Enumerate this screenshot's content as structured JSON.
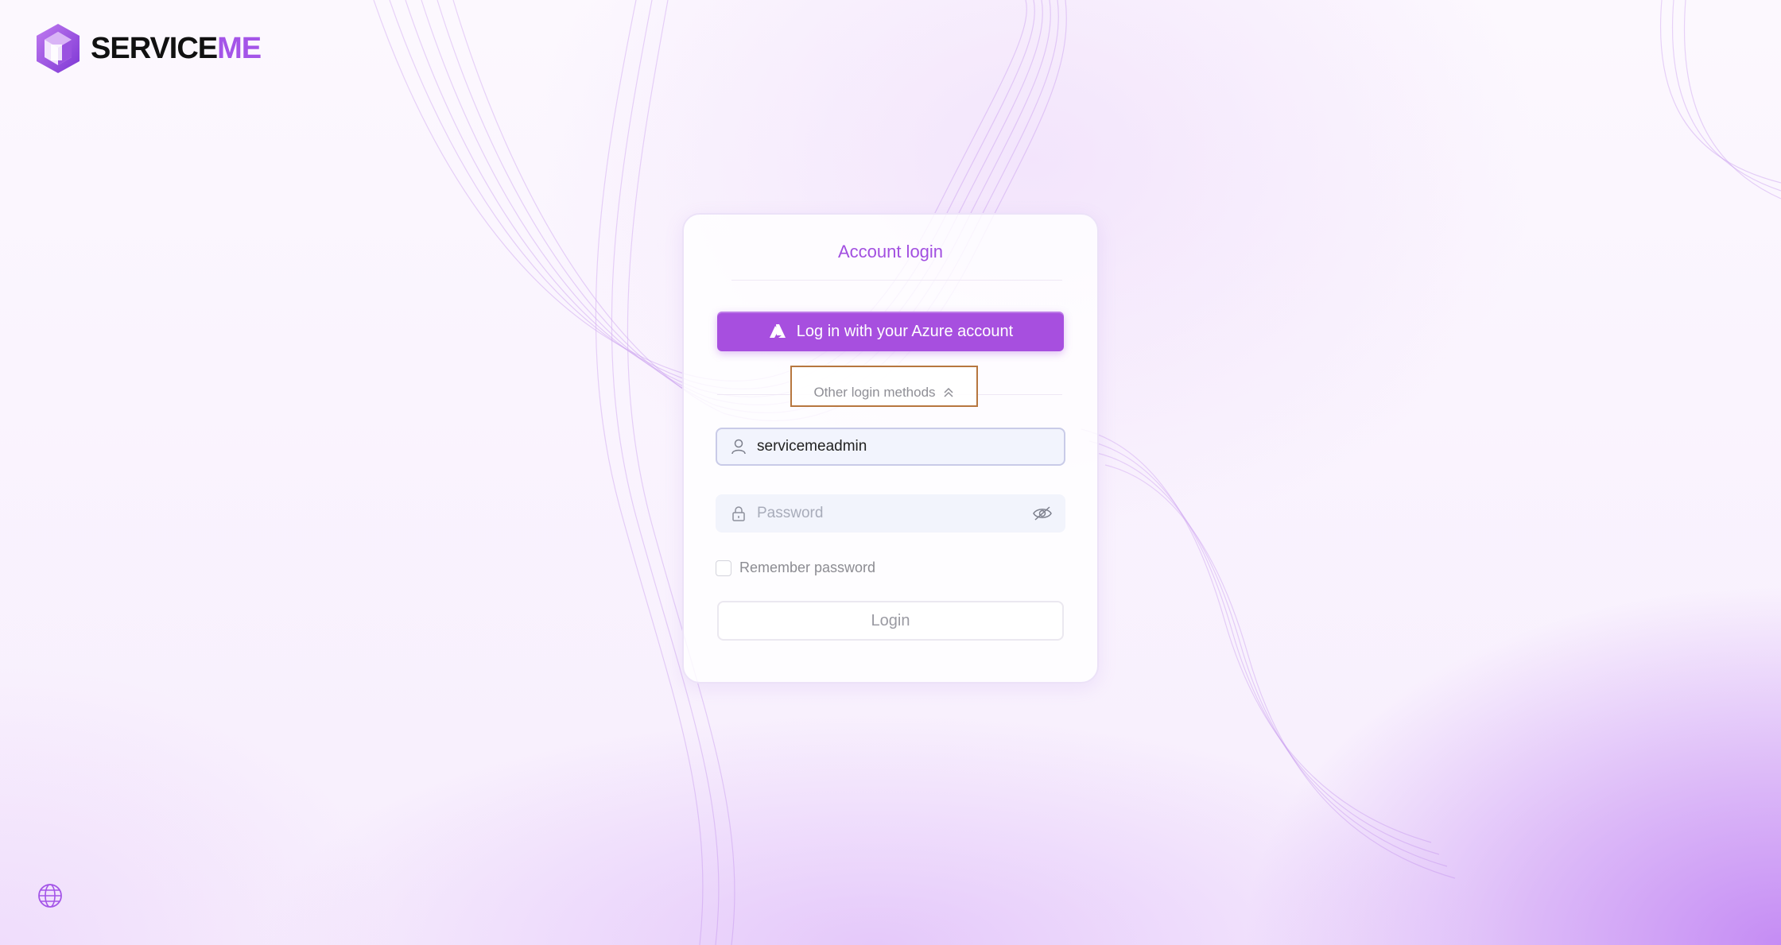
{
  "brand": {
    "name_primary": "SERVICE",
    "name_accent": "ME",
    "accent_color": "#a455e8"
  },
  "login_card": {
    "title": "Account login",
    "azure_button_label": "Log in with your Azure account",
    "azure_icon": "azure-icon",
    "other_methods_label": "Other login methods",
    "other_methods_icon": "chevron-double-up-icon",
    "username": {
      "value": "servicemeadmin",
      "icon": "user-icon"
    },
    "password": {
      "value": "",
      "placeholder": "Password",
      "icon": "lock-icon",
      "toggle_icon": "eye-off-icon"
    },
    "remember_label": "Remember password",
    "remember_checked": false,
    "login_button_label": "Login"
  },
  "footer": {
    "language_icon": "globe-icon"
  },
  "colors": {
    "primary": "#a74fdf",
    "title": "#a24fe0",
    "highlight_border": "#b7773f"
  }
}
